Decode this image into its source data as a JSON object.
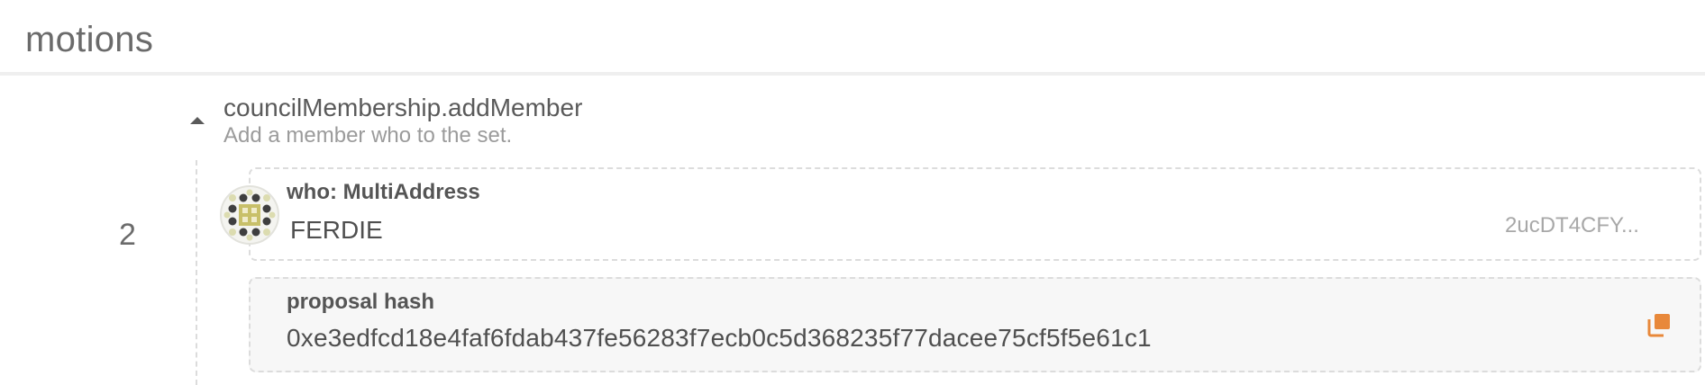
{
  "header": {
    "title": "motions"
  },
  "motion": {
    "index": "2",
    "collapse_icon": "chevron-up-icon",
    "call": {
      "name": "councilMembership.addMember",
      "description": "Add a member who to the set."
    },
    "param": {
      "label": "who: MultiAddress",
      "value": "FERDIE",
      "address": "2ucDT4CFY..."
    },
    "proposal_hash": {
      "label": "proposal hash",
      "value": "0xe3edfcd18e4faf6fdab437fe56283f7ecb0c5d368235f77dacee75cf5f5e61c1",
      "copy_icon": "copy-icon"
    }
  },
  "colors": {
    "accent": "#e8883a",
    "text": "#5a5a5a",
    "muted": "#9b9b9b",
    "border": "#dcdcdc"
  }
}
